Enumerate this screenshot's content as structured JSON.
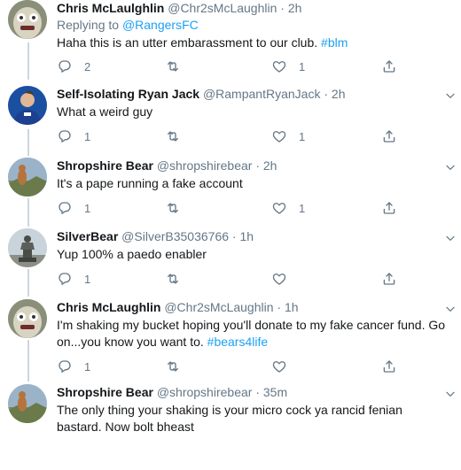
{
  "tweets": [
    {
      "name": "Chris McLaulghlin",
      "handle": "@Chr2sMcLaughlin",
      "time": "2h",
      "replying_label": "Replying to",
      "replying_to": "@RangersFC",
      "text": "Haha this is an utter embarassment to our club.",
      "hashtag": "#blm",
      "replies": "2",
      "retweets": "",
      "likes": "1"
    },
    {
      "name": "Self-Isolating Ryan Jack",
      "handle": "@RampantRyanJack",
      "time": "2h",
      "text": "What a weird guy",
      "replies": "1",
      "retweets": "",
      "likes": "1"
    },
    {
      "name": "Shropshire Bear",
      "handle": "@shropshirebear",
      "time": "2h",
      "text": "It's a pape running a fake account",
      "replies": "1",
      "retweets": "",
      "likes": "1"
    },
    {
      "name": "SilverBear",
      "handle": "@SilverB35036766",
      "time": "1h",
      "text": "Yup 100% a paedo enabler",
      "replies": "1",
      "retweets": "",
      "likes": ""
    },
    {
      "name": "Chris McLaughlin",
      "handle": "@Chr2sMcLaughlin",
      "time": "1h",
      "text": "I'm shaking my bucket hoping you'll donate to my fake cancer fund. Go on...you know you want to.",
      "hashtag": "#bears4life",
      "replies": "1",
      "retweets": "",
      "likes": ""
    },
    {
      "name": "Shropshire Bear",
      "handle": "@shropshirebear",
      "time": "35m",
      "text": "The only thing your shaking is your micro cock ya rancid fenian bastard. Now bolt bheast",
      "replies": "",
      "retweets": "",
      "likes": ""
    }
  ],
  "separator": "·",
  "colors": {
    "accent": "#1da1f2",
    "secondary": "#657786",
    "divider": "#e6ecf0",
    "thread_line": "#ccd6dd"
  }
}
